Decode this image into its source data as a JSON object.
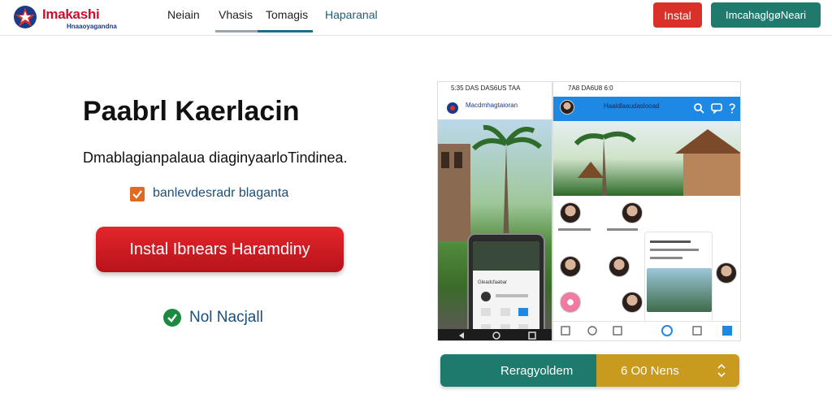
{
  "header": {
    "logo_name": "Imakashi",
    "logo_tagline": "Hnaaoyagandna",
    "nav": [
      {
        "label": "Neiain"
      },
      {
        "label": "Vhasis"
      },
      {
        "label": "Tomagis"
      },
      {
        "label": "Haparanal"
      }
    ],
    "install_label": "Instal",
    "login_label": "ImcahaglgøNeari"
  },
  "hero": {
    "title": "Paabrl Kaerlacin",
    "subtitle": "Dmablagianpalaua diaginyaarloTindinea.",
    "checkbox_label": "banlevdesradr blaganta",
    "button_label": "Instal Ibnears Haramdiny",
    "ok_label": "Nol Nacjall"
  },
  "phones": {
    "left_status": "5:35 DAS DAS6US TAA",
    "left_app_title": "Macdmhagtaioran",
    "mini_label": "Gleadcfaabar",
    "right_status": "7A8 DA6U8 6:0",
    "right_app_title": "Haaldlaaudaslooad"
  },
  "bottom_bar": {
    "left_label": "Reragyoldem",
    "right_value": "6 O0 Nens"
  },
  "colors": {
    "install": "#d9302a",
    "login": "#1f7a6d",
    "primary_button": "#d0161f",
    "bar_left": "#1e7a6c",
    "bar_right": "#c89a1e",
    "checkbox": "#e06a1f",
    "ok_check": "#1b8a3f"
  }
}
